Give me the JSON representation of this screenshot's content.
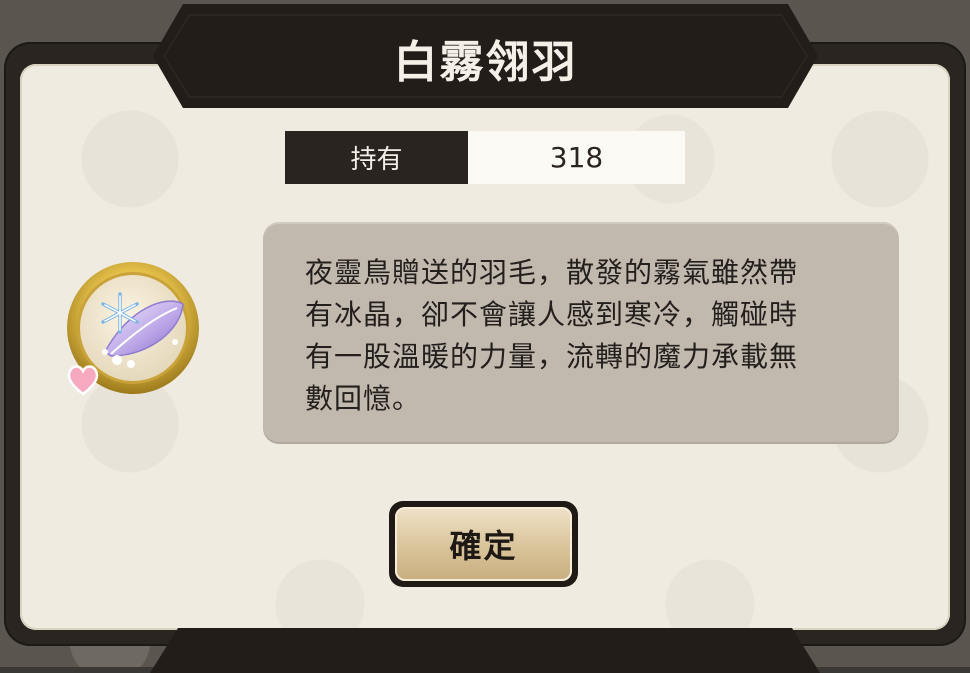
{
  "dialog": {
    "title": "白霧翎羽",
    "holdings": {
      "label": "持有",
      "value": "318"
    },
    "item": {
      "icon": "snowflake-feather-icon",
      "badge": "heart-icon"
    },
    "description": "夜靈鳥贈送的羽毛，散發的霧氣雖然帶\n有冰晶，卻不會讓人感到寒冷，觸碰時\n有一股溫暖的力量，流轉的魔力承載無\n數回憶。",
    "confirm_label": "確定"
  },
  "colors": {
    "frame": "#221d19",
    "panel": "#efebe0",
    "description_box": "#c1b8ae",
    "button_gold": "#d7c196"
  }
}
